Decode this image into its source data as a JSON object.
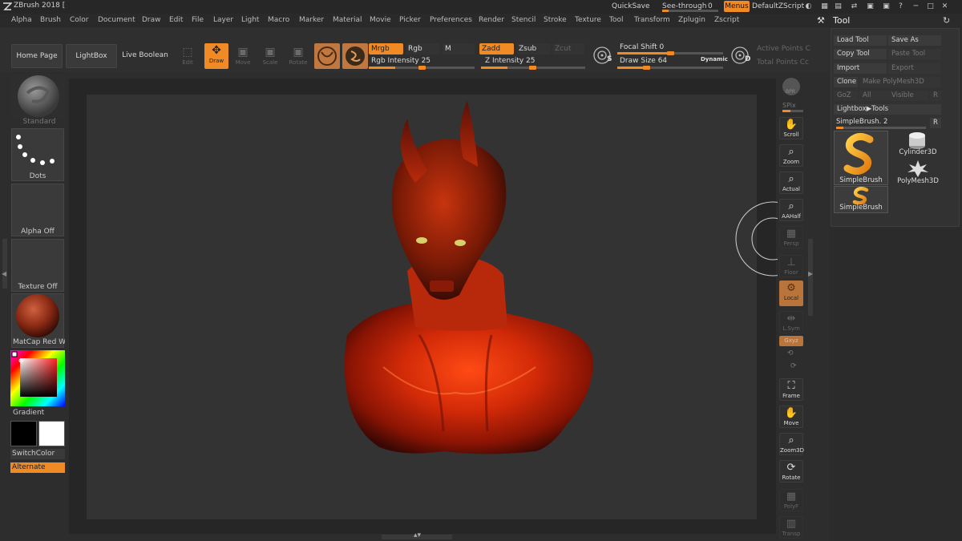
{
  "title_bar": {
    "app_title": "ZBrush 2018 [",
    "quicksave": "QuickSave",
    "see_through_label": "See-through",
    "see_through_value": "0",
    "menus": "Menus",
    "script": "DefaultZScript"
  },
  "menubar": [
    "Alpha",
    "Brush",
    "Color",
    "Document",
    "Draw",
    "Edit",
    "File",
    "Layer",
    "Light",
    "Macro",
    "Marker",
    "Material",
    "Movie",
    "Picker",
    "Preferences",
    "Render",
    "Stencil",
    "Stroke",
    "Texture",
    "Tool",
    "Transform",
    "Zplugin",
    "Zscript"
  ],
  "toolbar": {
    "home_page": "Home Page",
    "lightbox": "LightBox",
    "live_boolean": "Live Boolean",
    "edit": "Edit",
    "draw": "Draw",
    "move": "Move",
    "scale": "Scale",
    "rotate": "Rotate",
    "mrgb": "Mrgb",
    "rgb": "Rgb",
    "m": "M",
    "rgb_intensity": "Rgb Intensity 25",
    "zadd": "Zadd",
    "zsub": "Zsub",
    "zcut": "Zcut",
    "z_intensity": "Z Intensity 25",
    "focal_shift": "Focal Shift 0",
    "draw_size": "Draw Size 64",
    "dynamic": "Dynamic",
    "active_points": "Active Points C",
    "total_points": "Total Points Cc",
    "s_letter": "S",
    "d_letter": "D"
  },
  "left_panel": {
    "standard": "Standard",
    "dots": "Dots",
    "alpha_off": "Alpha Off",
    "texture_off": "Texture Off",
    "matcap": "MatCap Red Wa:",
    "gradient": "Gradient",
    "switch_color": "SwitchColor",
    "alternate": "Alternate"
  },
  "right_shelf": {
    "bpr": "BPR",
    "spix": "SPix",
    "scroll": "Scroll",
    "zoom": "Zoom",
    "actual": "Actual",
    "aahalf": "AAHalf",
    "persp": "Persp",
    "floor": "Floor",
    "local": "Local",
    "lsym": "L.Sym",
    "gxyz": "Gxyz",
    "frame": "Frame",
    "move": "Move",
    "zoom3d": "Zoom3D",
    "rotate": "Rotate",
    "polyf": "PolyF",
    "transp": "Transp"
  },
  "tool_panel": {
    "title": "Tool",
    "load_tool": "Load Tool",
    "save_as": "Save As",
    "copy_tool": "Copy Tool",
    "paste_tool": "Paste Tool",
    "import": "Import",
    "export": "Export",
    "clone": "Clone",
    "make_polymesh": "Make PolyMesh3D",
    "goz": "GoZ",
    "all": "All",
    "visible": "Visible",
    "r": "R",
    "lightbox_tools": "Lightbox▶Tools",
    "simplebrush_slider": "SimpleBrush. 2",
    "r2": "R",
    "thumb_simplebrush": "SimpleBrush",
    "thumb_cylinder": "Cylinder3D",
    "thumb_polymesh": "PolyMesh3D",
    "thumb_simplebrush2": "SimpleBrush"
  },
  "colors": {
    "accent": "#f08a24",
    "panel": "#2d2d2d",
    "canvas": "#262626",
    "document": "#333333",
    "model_red": "#c8260a"
  }
}
